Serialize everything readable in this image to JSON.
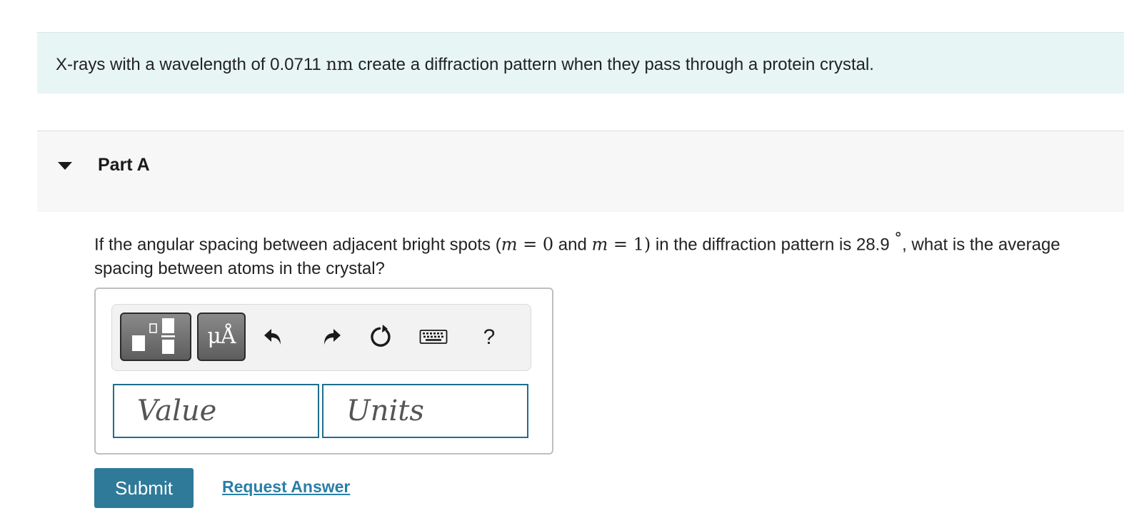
{
  "intro": {
    "text_before": "X-rays with a wavelength of 0.0711 ",
    "unit": "nm",
    "text_after": " create a diffraction pattern when they pass through a protein crystal."
  },
  "part": {
    "title": "Part A"
  },
  "question": {
    "t1": "If the angular spacing between adjacent bright spots (",
    "m1": "m",
    "eq1": " = 0",
    "t2": " and ",
    "m2": "m",
    "eq2": " = 1)",
    "t3": " in the diffraction pattern is 28.9 ",
    "deg": "°",
    "t4": ", what is the average spacing between atoms in the crystal?"
  },
  "toolbar": {
    "units_label": "μÅ",
    "help_label": "?",
    "icons": [
      "templates-icon",
      "undo-icon",
      "redo-icon",
      "reset-icon",
      "keyboard-icon",
      "help-icon"
    ]
  },
  "inputs": {
    "value_placeholder": "Value",
    "value": "",
    "units_placeholder": "Units",
    "units": ""
  },
  "actions": {
    "submit_label": "Submit",
    "request_label": "Request Answer"
  },
  "colors": {
    "banner_bg": "#e8f5f5",
    "part_bg": "#f7f7f7",
    "accent": "#2f7a99",
    "link": "#2a7fa6",
    "field_border": "#1e6e8c"
  }
}
